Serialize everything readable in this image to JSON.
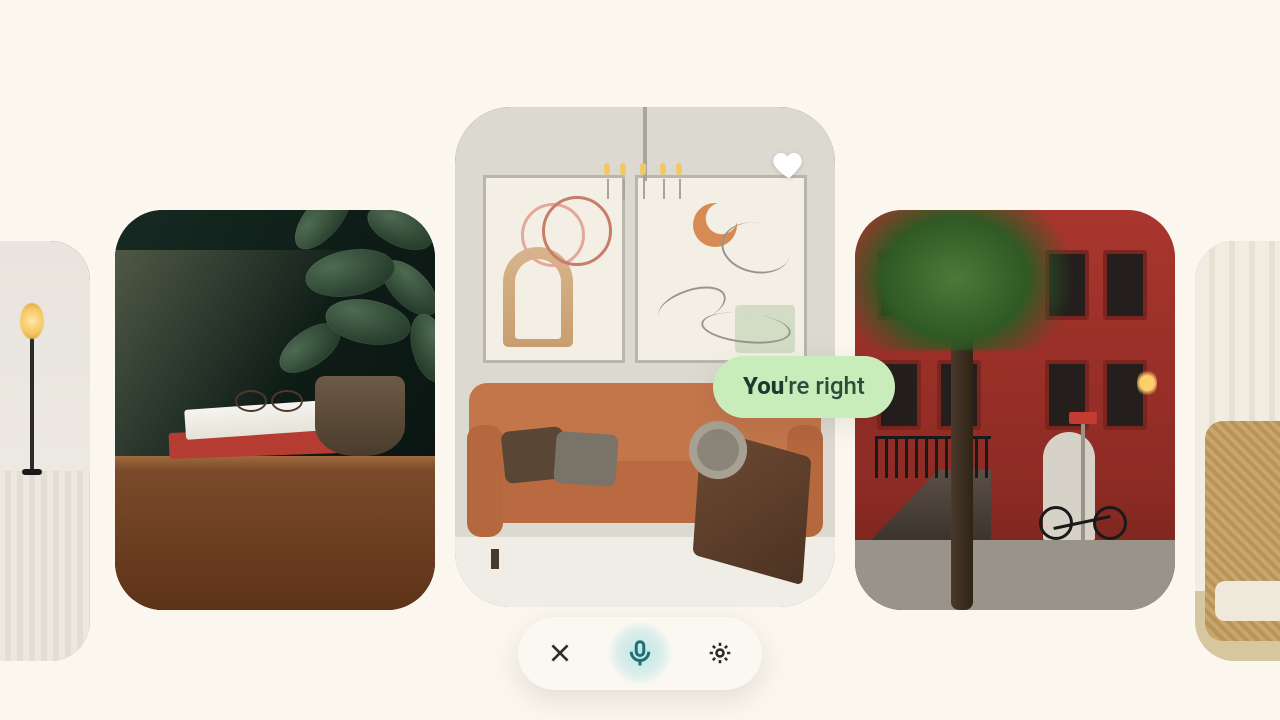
{
  "carousel": {
    "cards": [
      {
        "name": "card-bedroom-corner",
        "favorite": false
      },
      {
        "name": "card-plant-dresser",
        "favorite": false
      },
      {
        "name": "card-living-room",
        "favorite": true
      },
      {
        "name": "card-brownstone-street",
        "favorite": false
      },
      {
        "name": "card-rattan-chair",
        "favorite": false
      }
    ]
  },
  "speech": {
    "bold": "You",
    "rest": "'re right"
  },
  "voicebar": {
    "close_label": "Close",
    "mic_label": "Microphone",
    "settings_label": "Settings"
  },
  "icons": {
    "heart": "heart-icon",
    "close": "close-icon",
    "mic": "mic-icon",
    "gear": "gear-icon"
  },
  "colors": {
    "background": "#FBF7EE",
    "speech_pill": "#c8edbb",
    "speech_text": "#1e3a2f",
    "mic_accent": "#1f6f73"
  }
}
